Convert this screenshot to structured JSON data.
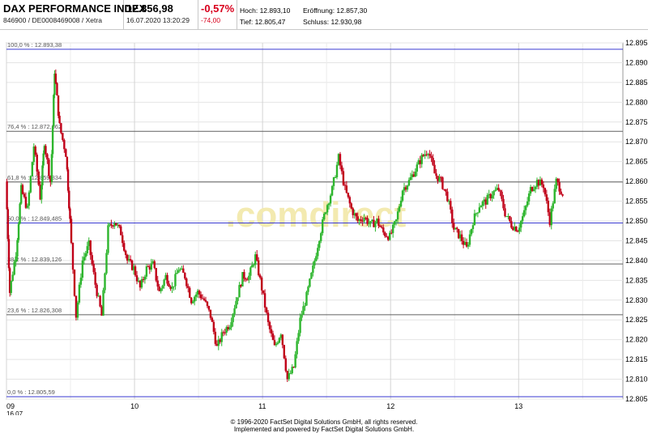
{
  "header": {
    "name": "DAX PERFORMANCE INDEX",
    "ids": "846900 / DE0008469008 / Xetra",
    "price": "12.856,98",
    "timestamp": "16.07.2020 13:20:29",
    "change_pct": "-0,57%",
    "change_abs": "-74,00",
    "high": "Hoch: 12.893,10",
    "open": "Eröffnung: 12.857,30",
    "low": "Tief: 12.805,47",
    "close": "Schluss: 12.930,98"
  },
  "watermark": ".comdirect",
  "footer": {
    "line1": "© 1996-2020 FactSet Digital Solutions GmbH, all rights reserved.",
    "line2": "Implemented and powered by FactSet Digital Solutions GmbH."
  },
  "chart_data": {
    "type": "candlestick",
    "y_ticks": [
      "12.895",
      "12.890",
      "12.885",
      "12.880",
      "12.875",
      "12.870",
      "12.865",
      "12.860",
      "12.855",
      "12.850",
      "12.845",
      "12.840",
      "12.835",
      "12.830",
      "12.825",
      "12.820",
      "12.815",
      "12.810",
      "12.805"
    ],
    "ylim": [
      12805,
      12895
    ],
    "x_ticks": [
      "09",
      "10",
      "11",
      "12",
      "13"
    ],
    "x_sublabel": "16.07.",
    "xlim": [
      9,
      13.8
    ],
    "grid": true,
    "fib_levels": [
      {
        "label": "100,0 % : 12.893,38",
        "value": 12893.38,
        "color": "#3a3ad0"
      },
      {
        "label": "76,4 % : 12.872,662",
        "value": 12872.662,
        "color": "#606060"
      },
      {
        "label": "61,8 % : 12.859,834",
        "value": 12859.834,
        "color": "#606060"
      },
      {
        "label": "50,0 % : 12.849,485",
        "value": 12849.485,
        "color": "#3a3ad0"
      },
      {
        "label": "38,2 % : 12.839,126",
        "value": 12839.126,
        "color": "#606060"
      },
      {
        "label": "23,6 % : 12.826,308",
        "value": 12826.308,
        "color": "#606060"
      },
      {
        "label": "0,0 % : 12.805,59",
        "value": 12805.59,
        "color": "#3a3ad0"
      }
    ],
    "colors": {
      "up": "#2db52d",
      "down": "#c00018"
    },
    "path": [
      [
        9.0,
        12860
      ],
      [
        9.03,
        12832
      ],
      [
        9.08,
        12842
      ],
      [
        9.12,
        12858
      ],
      [
        9.17,
        12853
      ],
      [
        9.22,
        12869
      ],
      [
        9.27,
        12856
      ],
      [
        9.3,
        12870
      ],
      [
        9.35,
        12860
      ],
      [
        9.38,
        12888
      ],
      [
        9.42,
        12874
      ],
      [
        9.47,
        12867
      ],
      [
        9.5,
        12850
      ],
      [
        9.55,
        12826
      ],
      [
        9.6,
        12840
      ],
      [
        9.65,
        12844
      ],
      [
        9.7,
        12834
      ],
      [
        9.75,
        12826
      ],
      [
        9.8,
        12848
      ],
      [
        9.85,
        12850
      ],
      [
        9.9,
        12847
      ],
      [
        9.95,
        12840
      ],
      [
        10.0,
        12838
      ],
      [
        10.05,
        12833
      ],
      [
        10.1,
        12838
      ],
      [
        10.15,
        12839
      ],
      [
        10.2,
        12832
      ],
      [
        10.25,
        12836
      ],
      [
        10.3,
        12833
      ],
      [
        10.35,
        12838
      ],
      [
        10.4,
        12836
      ],
      [
        10.45,
        12830
      ],
      [
        10.5,
        12832
      ],
      [
        10.55,
        12830
      ],
      [
        10.6,
        12826
      ],
      [
        10.65,
        12818
      ],
      [
        10.7,
        12822
      ],
      [
        10.75,
        12824
      ],
      [
        10.8,
        12830
      ],
      [
        10.85,
        12836
      ],
      [
        10.9,
        12836
      ],
      [
        10.95,
        12841
      ],
      [
        11.0,
        12833
      ],
      [
        11.05,
        12824
      ],
      [
        11.1,
        12818
      ],
      [
        11.15,
        12822
      ],
      [
        11.2,
        12810
      ],
      [
        11.25,
        12813
      ],
      [
        11.3,
        12825
      ],
      [
        11.35,
        12831
      ],
      [
        11.4,
        12838
      ],
      [
        11.45,
        12846
      ],
      [
        11.5,
        12853
      ],
      [
        11.55,
        12858
      ],
      [
        11.6,
        12866
      ],
      [
        11.65,
        12858
      ],
      [
        11.7,
        12853
      ],
      [
        11.75,
        12850
      ],
      [
        11.8,
        12851
      ],
      [
        11.85,
        12849
      ],
      [
        11.9,
        12850
      ],
      [
        11.95,
        12847
      ],
      [
        12.0,
        12846
      ],
      [
        12.05,
        12850
      ],
      [
        12.1,
        12858
      ],
      [
        12.15,
        12860
      ],
      [
        12.2,
        12863
      ],
      [
        12.25,
        12866
      ],
      [
        12.3,
        12868
      ],
      [
        12.35,
        12862
      ],
      [
        12.4,
        12860
      ],
      [
        12.45,
        12856
      ],
      [
        12.5,
        12848
      ],
      [
        12.55,
        12846
      ],
      [
        12.6,
        12843
      ],
      [
        12.65,
        12850
      ],
      [
        12.7,
        12854
      ],
      [
        12.75,
        12855
      ],
      [
        12.8,
        12857
      ],
      [
        12.85,
        12858
      ],
      [
        12.9,
        12852
      ],
      [
        12.95,
        12849
      ],
      [
        13.0,
        12848
      ],
      [
        13.05,
        12852
      ],
      [
        13.1,
        12858
      ],
      [
        13.15,
        12860
      ],
      [
        13.2,
        12859
      ],
      [
        13.25,
        12850
      ],
      [
        13.3,
        12860
      ],
      [
        13.35,
        12857
      ]
    ]
  }
}
